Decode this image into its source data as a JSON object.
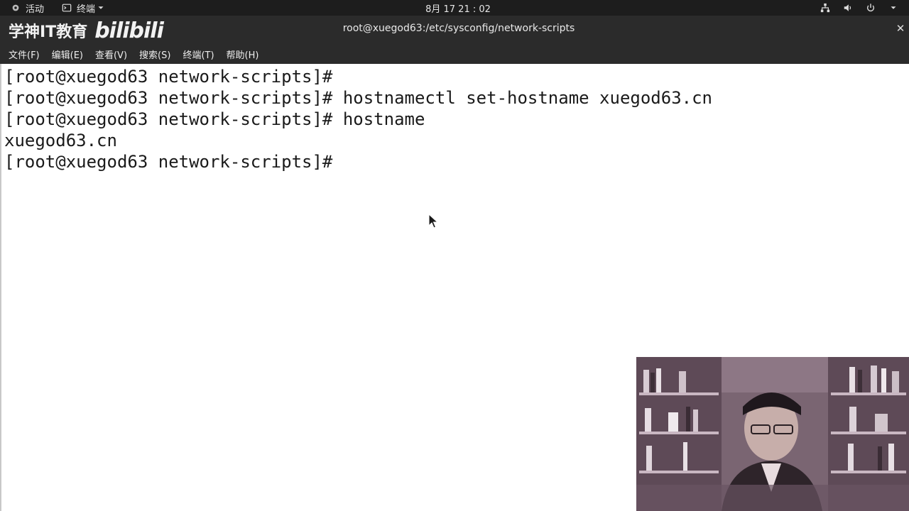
{
  "topbar": {
    "activities_label": "活动",
    "app_label": "终端",
    "clock": "8月 17  21 : 02",
    "icons": [
      "network-icon",
      "volume-icon",
      "power-icon"
    ]
  },
  "window": {
    "watermark_text": "学神IT教育",
    "watermark_logo": "bilibili",
    "title": "root@xuegod63:/etc/sysconfig/network-scripts"
  },
  "menubar": {
    "items": [
      "文件(F)",
      "编辑(E)",
      "查看(V)",
      "搜索(S)",
      "终端(T)",
      "帮助(H)"
    ]
  },
  "terminal": {
    "lines": [
      "[root@xuegod63 network-scripts]#",
      "[root@xuegod63 network-scripts]# hostnamectl set-hostname xuegod63.cn",
      "[root@xuegod63 network-scripts]# hostname",
      "xuegod63.cn",
      "[root@xuegod63 network-scripts]#"
    ]
  },
  "colors": {
    "topbar_bg": "#1d1d1d",
    "titlebar_bg": "#2b2b2b",
    "terminal_bg": "#ffffff",
    "terminal_fg": "#1a1a1a"
  }
}
